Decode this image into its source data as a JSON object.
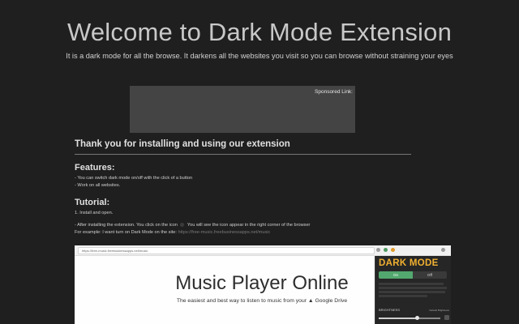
{
  "hero": {
    "title": "Welcome to Dark Mode Extension",
    "subtitle": "It is a dark mode for all the browse. It darkens all the websites you visit so you can browse without straining your eyes"
  },
  "ad": {
    "label": "Sponsored Link:"
  },
  "thanks": "Thank you for installing and using our extension",
  "features": {
    "title": "Features:",
    "items": [
      "- You can switch dark mode on/off with the click of a button",
      "- Work on all websites."
    ]
  },
  "tutorial": {
    "title": "Tutorial:",
    "step1": "1. Install and open.",
    "step2_part1": "- After installing the extension. You click on the icon",
    "step2_part2": "You will see the icon appear in the right corner of the browser",
    "example_prefix": "For example: I want turn on Dark Mode on the site:",
    "example_link": "https://free-music.freebusinessapps.net/music"
  },
  "screenshot": {
    "url": "https://free-music.freebusinessapps.net/music",
    "page_title": "Music Player Online",
    "page_subtitle": "The easiest and best way to listen to music from your ▲ Google Drive",
    "popup": {
      "title": "DARK MODE",
      "on_label": "On",
      "off_label": "Off",
      "brightness_label": "BRIGHTNESS",
      "brightness_default": "Default Brightness",
      "brightness_level": 0.62,
      "accent": "#f0b030",
      "toggle_color": "#53a86f"
    }
  }
}
